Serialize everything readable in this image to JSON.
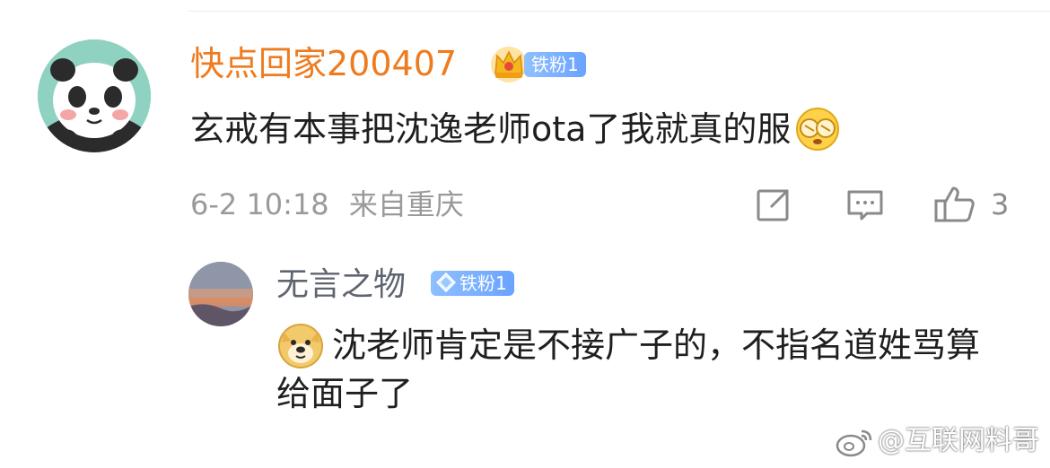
{
  "comment": {
    "author": "快点回家200407",
    "badge": "铁粉1",
    "text": "玄戒有本事把沈逸老师ota了我就真的服",
    "timestamp": "6-2 10:18",
    "location": "来自重庆",
    "likes": "3",
    "author_color": "#ef7b1f"
  },
  "reply": {
    "author": "无言之物",
    "badge": "铁粉1",
    "text": "沈老师肯定是不接广子的，不指名道姓骂算给面子了"
  },
  "actions": {
    "icons": [
      "share-icon",
      "comment-icon",
      "like-icon"
    ]
  },
  "watermark": {
    "text": "@互联网料哥"
  },
  "colors": {
    "badge": "#6aa3ff",
    "meta": "#9a9a9a",
    "reply_author": "#5f6570"
  }
}
